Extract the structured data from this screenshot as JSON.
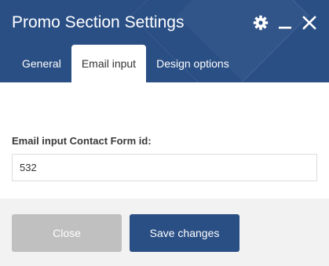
{
  "window": {
    "title": "Promo Section Settings",
    "controls": [
      "gear-icon",
      "minimize-icon",
      "close-icon"
    ]
  },
  "tabs": [
    {
      "label": "General",
      "active": false
    },
    {
      "label": "Email input",
      "active": true
    },
    {
      "label": "Design options",
      "active": false
    }
  ],
  "form": {
    "field_label": "Email input Contact Form id:",
    "field_value": "532"
  },
  "footer": {
    "close_label": "Close",
    "save_label": "Save changes"
  },
  "colors": {
    "header_bg": "#2a4f85",
    "save_button": "#2a4f85",
    "close_button": "#c0c0c0",
    "footer_bg": "#f2f2f2"
  }
}
